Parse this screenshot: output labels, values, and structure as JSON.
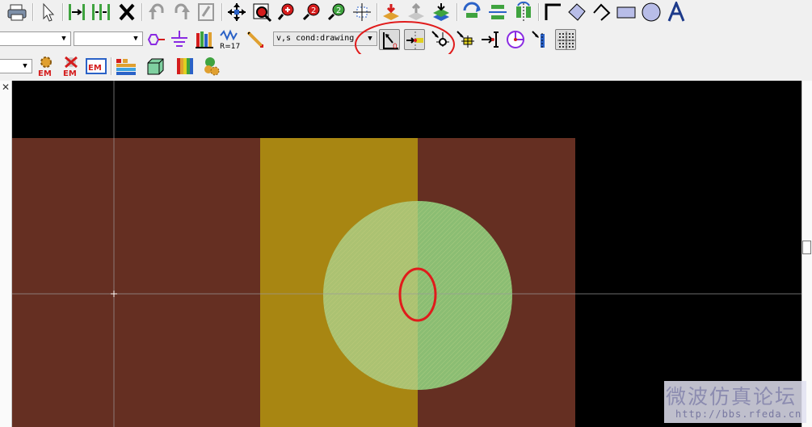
{
  "toolbar2": {
    "layer_combo": {
      "value": ""
    },
    "second_combo": {
      "value": ""
    },
    "mode_combo": {
      "value": "v,s cond:drawing"
    },
    "r_label": "R=17"
  },
  "toolbar3": {
    "em_label": "EM"
  },
  "canvas": {
    "background": "#000000",
    "substrate_color": "#652f22",
    "strip_color": "#a88612",
    "disk_color": "#8bbd73",
    "annotation_color": "#e01b1b"
  },
  "watermark": {
    "title": "微波仿真论坛",
    "url": "http://bbs.rfeda.cn"
  }
}
